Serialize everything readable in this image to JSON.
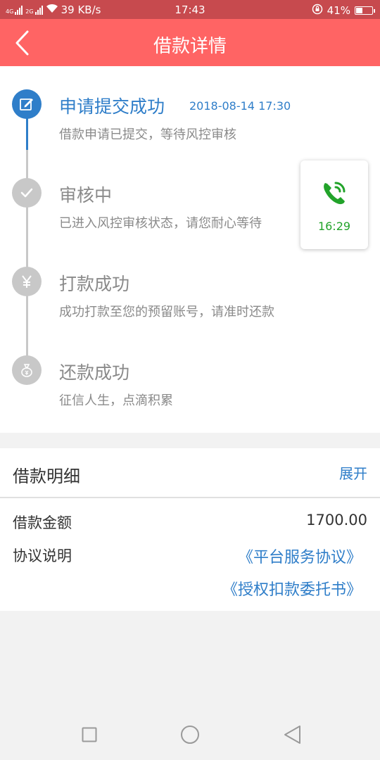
{
  "status_bar": {
    "network_left": "4G",
    "network_right": "2G",
    "speed": "39 KB/s",
    "time": "17:43",
    "battery": "41%",
    "battery_level": 0.41
  },
  "header": {
    "title": "借款详情"
  },
  "steps": [
    {
      "title": "申请提交成功",
      "time": "2018-08-14 17:30",
      "desc": "借款申请已提交，等待风控审核",
      "icon": "edit-icon",
      "active": true
    },
    {
      "title": "审核中",
      "time": "",
      "desc": "已进入风控审核状态，请您耐心等待",
      "icon": "check-icon",
      "active": false
    },
    {
      "title": "打款成功",
      "time": "",
      "desc": "成功打款至您的预留账号，请准时还款",
      "icon": "yen-icon",
      "active": false
    },
    {
      "title": "还款成功",
      "time": "",
      "desc": "征信人生，点滴积累",
      "icon": "money-bag-icon",
      "active": false
    }
  ],
  "call_card": {
    "time": "16:29",
    "icon": "phone-icon"
  },
  "loan_detail": {
    "section_title": "借款明细",
    "expand_label": "展开",
    "amount_label": "借款金额",
    "amount_value": "1700.00",
    "agreement_label": "协议说明",
    "agreement_links": [
      "《平台服务协议》",
      "《授权扣款委托书》"
    ]
  },
  "colors": {
    "header": "#ff6464",
    "status_bar": "#c74a4e",
    "active": "#2f7ec9",
    "inactive": "#c8c8c8",
    "call_green": "#22a32a"
  }
}
